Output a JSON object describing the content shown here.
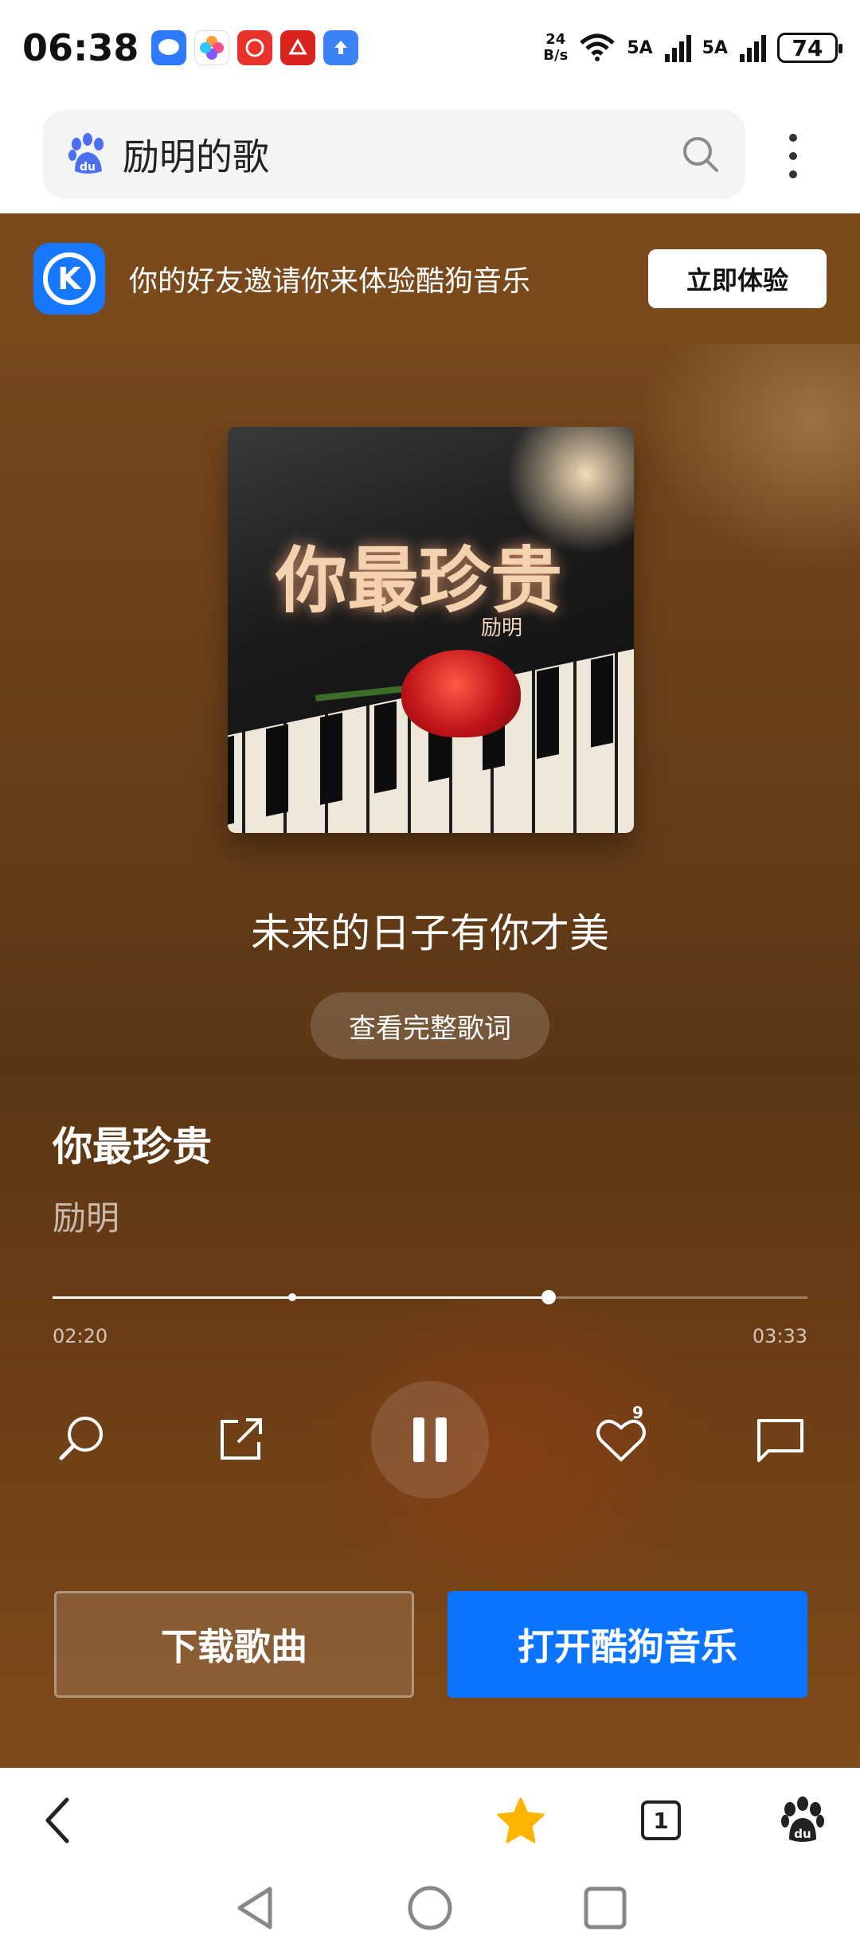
{
  "status_bar": {
    "time": "06:38",
    "net_speed_value": "24",
    "net_speed_unit": "B/s",
    "signal1": "5A",
    "signal2": "5A",
    "battery": "74"
  },
  "search": {
    "query": "励明的歌"
  },
  "invite": {
    "text": "你的好友邀请你来体验酷狗音乐",
    "button": "立即体验",
    "logo_letter": "K"
  },
  "album_art": {
    "title": "你最珍贵",
    "artist": "励明"
  },
  "player": {
    "current_lyric": "未来的日子有你才美",
    "view_lyrics_label": "查看完整歌词",
    "song_title": "你最珍贵",
    "artist": "励明",
    "time_current": "02:20",
    "time_total": "03:33",
    "progress_fraction": 0.657,
    "buffer_fraction": 0.318,
    "like_count": "9"
  },
  "actions": {
    "download": "下载歌曲",
    "open_app": "打开酷狗音乐"
  },
  "toolbar": {
    "tab_count": "1"
  },
  "colors": {
    "accent_blue": "#0b74ff",
    "star_yellow": "#ffb400",
    "brown_bg": "#6b4019"
  }
}
